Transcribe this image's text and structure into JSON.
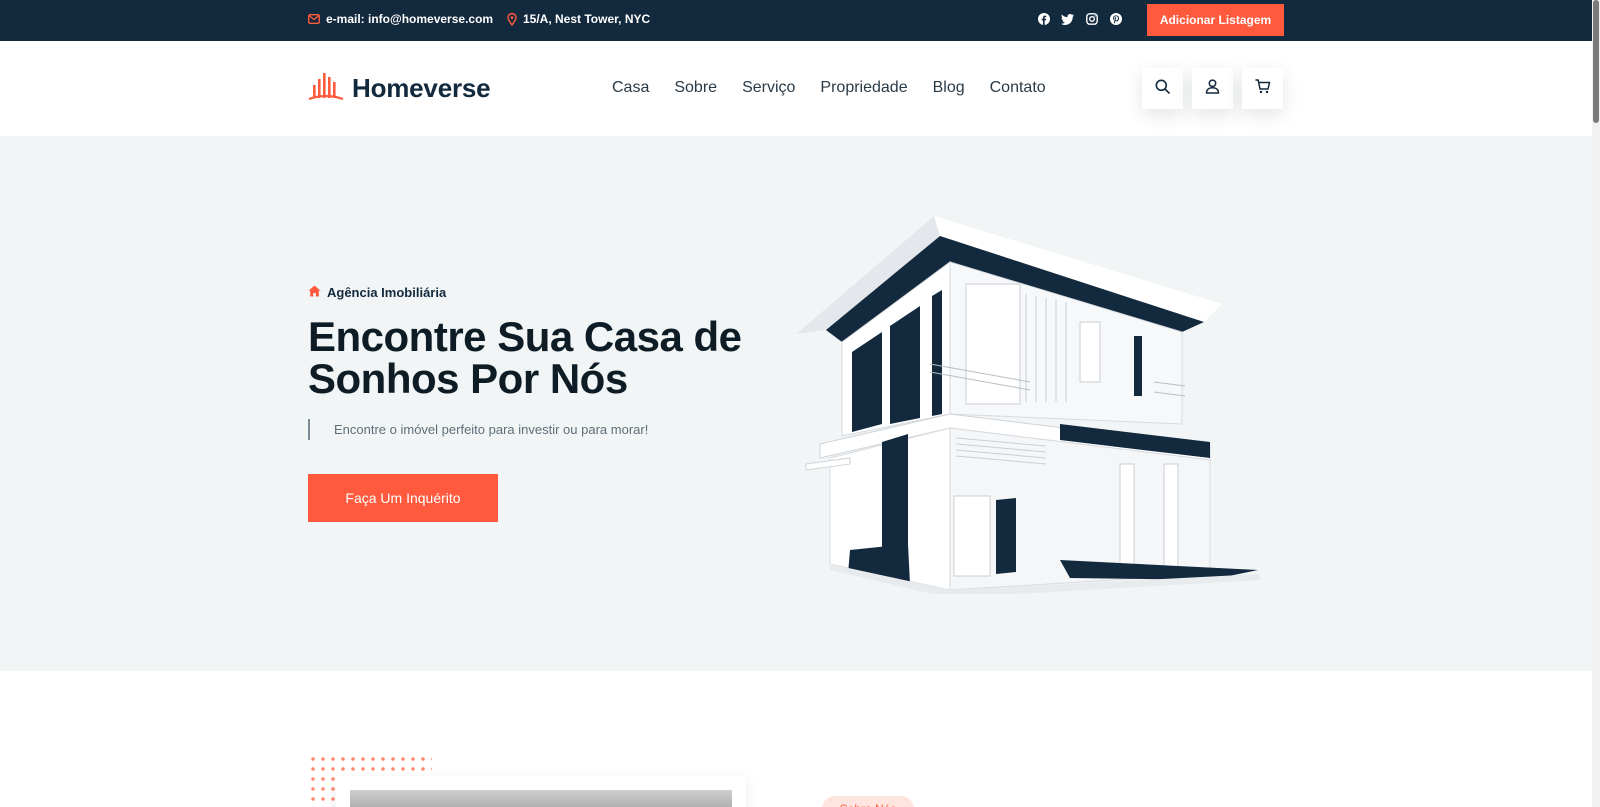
{
  "topbar": {
    "email": "e-mail: info@homeverse.com",
    "address": "15/A, Nest Tower, NYC",
    "social_icons": [
      "facebook-icon",
      "twitter-icon",
      "instagram-icon",
      "pinterest-icon"
    ],
    "add_listing_label": "Adicionar Listagem"
  },
  "header": {
    "logo_text": "Homeverse",
    "nav": [
      "Casa",
      "Sobre",
      "Serviço",
      "Propriedade",
      "Blog",
      "Contato"
    ],
    "action_icons": [
      "search-icon",
      "user-icon",
      "cart-icon"
    ]
  },
  "hero": {
    "tag": "Agência Imobiliária",
    "title_line1": "Encontre Sua Casa de",
    "title_line2": "Sonhos Por Nós",
    "subtitle": "Encontre o imóvel perfeito para investir ou para morar!",
    "button_label": "Faça Um Inquérito"
  },
  "about": {
    "tag": "Sobre Nós"
  },
  "colors": {
    "accent": "#ff5a3d",
    "navy": "#13293d",
    "hero_bg": "#f2f5f6"
  }
}
